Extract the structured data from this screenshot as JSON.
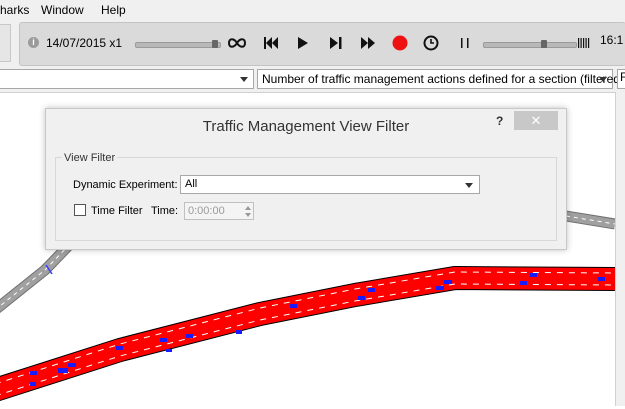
{
  "menu": {
    "items": [
      "harks",
      "Window",
      "Help"
    ]
  },
  "toolbar": {
    "date_speed": "14/07/2015 x1",
    "clock": "16:1",
    "info_glyph": "i"
  },
  "combos": {
    "left_value": "",
    "view_mode": "Number of traffic management actions defined for a section (filtered)"
  },
  "right_edge_label": "F",
  "dialog": {
    "title": "Traffic Management View Filter",
    "help": "?",
    "close": "✕",
    "group_title": "View Filter",
    "experiment_label": "Dynamic Experiment:",
    "experiment_value": "All",
    "time_filter_label": "Time Filter",
    "time_label": "Time:",
    "time_value": "0:00:00"
  },
  "colors": {
    "section_red": "#ff0000",
    "vehicle_blue": "#1a1aff",
    "road_grey": "#8c8c8c"
  }
}
